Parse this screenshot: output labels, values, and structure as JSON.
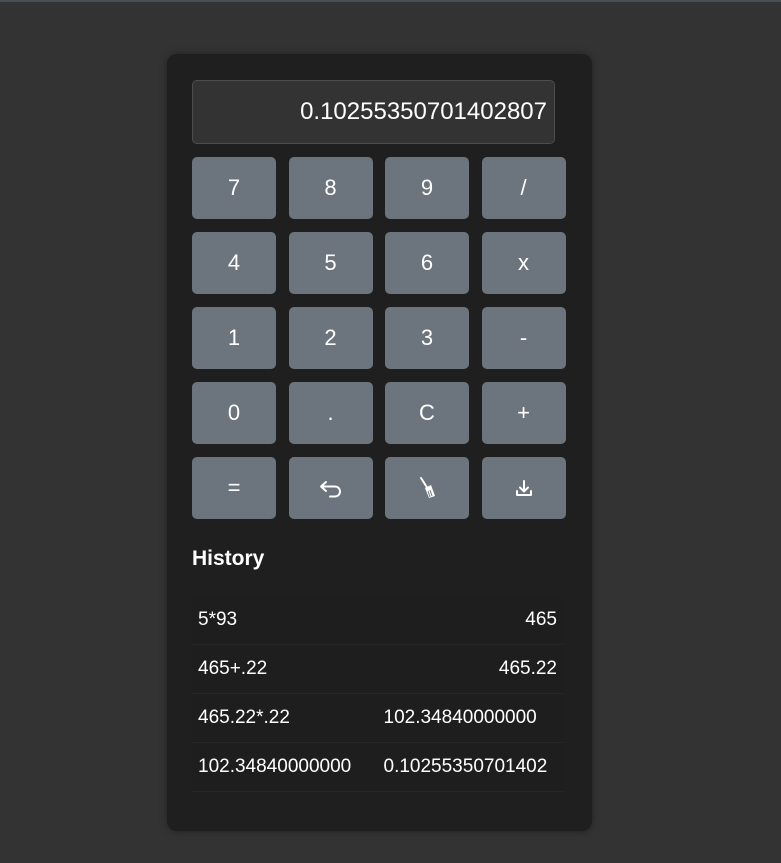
{
  "display": {
    "value": "0.10255350701402807"
  },
  "keypad": {
    "rows": [
      [
        "7",
        "8",
        "9",
        "/"
      ],
      [
        "4",
        "5",
        "6",
        "x"
      ],
      [
        "1",
        "2",
        "3",
        "-"
      ],
      [
        "0",
        ".",
        "C",
        "+"
      ]
    ],
    "equals_label": "=",
    "undo_icon": "undo-icon",
    "clear_history_icon": "broom-icon",
    "download_icon": "download-icon"
  },
  "history": {
    "title": "History",
    "entries": [
      {
        "expression": "5*93",
        "result": "465"
      },
      {
        "expression": "465+.22",
        "result": "465.22"
      },
      {
        "expression": "465.22*.22",
        "result": "102.34840000000"
      },
      {
        "expression": "102.34840000000",
        "result": "0.10255350701402"
      }
    ]
  },
  "colors": {
    "page_background": "#333333",
    "panel_background": "#1f1f1f",
    "display_background": "#333333",
    "key_background": "#6c757d",
    "text": "#ffffff"
  }
}
